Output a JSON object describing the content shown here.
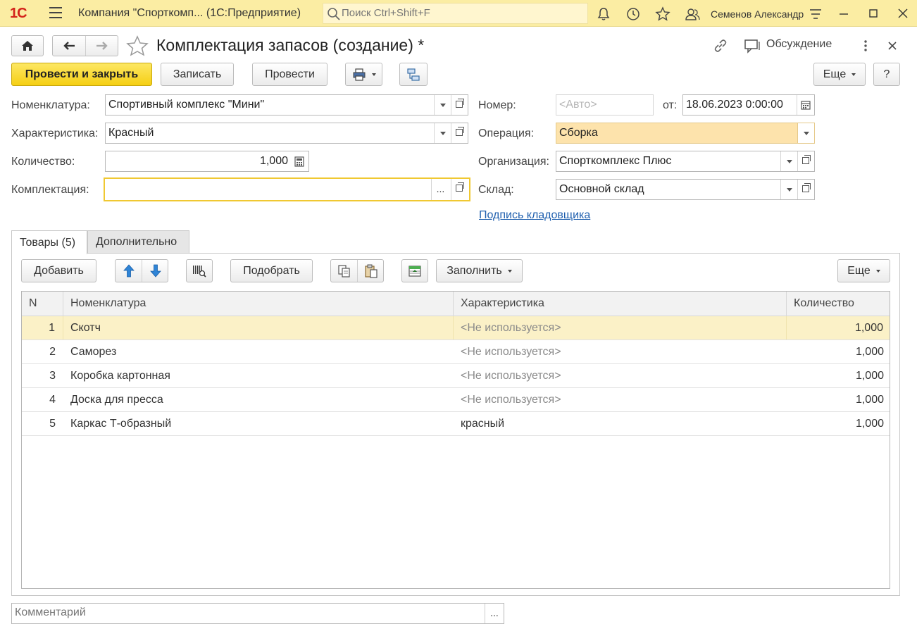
{
  "app": {
    "logo": "1С",
    "title": "Компания \"Спорткомп...  (1С:Предприятие)",
    "search_placeholder": "Поиск Ctrl+Shift+F",
    "user": "Семенов Александр"
  },
  "form": {
    "title": "Комплектация запасов (создание) *",
    "discussion_label": "Обсуждение"
  },
  "toolbar": {
    "post_and_close": "Провести и закрыть",
    "save": "Записать",
    "post": "Провести",
    "more": "Еще",
    "help": "?"
  },
  "fields": {
    "nomenclature_label": "Номенклатура:",
    "nomenclature_value": "Спортивный комплекс \"Мини\"",
    "characteristic_label": "Характеристика:",
    "characteristic_value": "Красный",
    "quantity_label": "Количество:",
    "quantity_value": "1,000",
    "kit_label": "Комплектация:",
    "kit_value": "",
    "kit_more": "...",
    "number_label": "Номер:",
    "number_placeholder": "<Авто>",
    "date_label": "от:",
    "date_value": "18.06.2023  0:00:00",
    "operation_label": "Операция:",
    "operation_value": "Сборка",
    "organization_label": "Организация:",
    "organization_value": "Спорткомплекс Плюс",
    "warehouse_label": "Склад:",
    "warehouse_value": "Основной склад",
    "storekeeper_link": "Подпись кладовщика"
  },
  "tabs": [
    {
      "label": "Товары (5)",
      "active": true
    },
    {
      "label": "Дополнительно",
      "active": false
    }
  ],
  "table_toolbar": {
    "add": "Добавить",
    "pick": "Подобрать",
    "fill": "Заполнить",
    "more": "Еще"
  },
  "table": {
    "columns": [
      "N",
      "Номенклатура",
      "Характеристика",
      "Количество"
    ],
    "rows": [
      {
        "n": "1",
        "name": "Скотч",
        "characteristic": "<Не используется>",
        "qty": "1,000",
        "selected": true,
        "placeholder": true
      },
      {
        "n": "2",
        "name": "Саморез",
        "characteristic": "<Не используется>",
        "qty": "1,000",
        "selected": false,
        "placeholder": true
      },
      {
        "n": "3",
        "name": "Коробка картонная",
        "characteristic": "<Не используется>",
        "qty": "1,000",
        "selected": false,
        "placeholder": true
      },
      {
        "n": "4",
        "name": "Доска для пресса",
        "characteristic": "<Не используется>",
        "qty": "1,000",
        "selected": false,
        "placeholder": true
      },
      {
        "n": "5",
        "name": "Каркас Т-образный",
        "characteristic": "красный",
        "qty": "1,000",
        "selected": false,
        "placeholder": false
      }
    ]
  },
  "comment": {
    "placeholder": "Комментарий",
    "more": "..."
  },
  "colors": {
    "titlebar": "#fbeda3",
    "primary_button": "#f5cf14",
    "selected_row": "#fbf1c7",
    "operation_highlight": "#fde3ac",
    "focus_border": "#f0c832",
    "link": "#1f5fae"
  }
}
